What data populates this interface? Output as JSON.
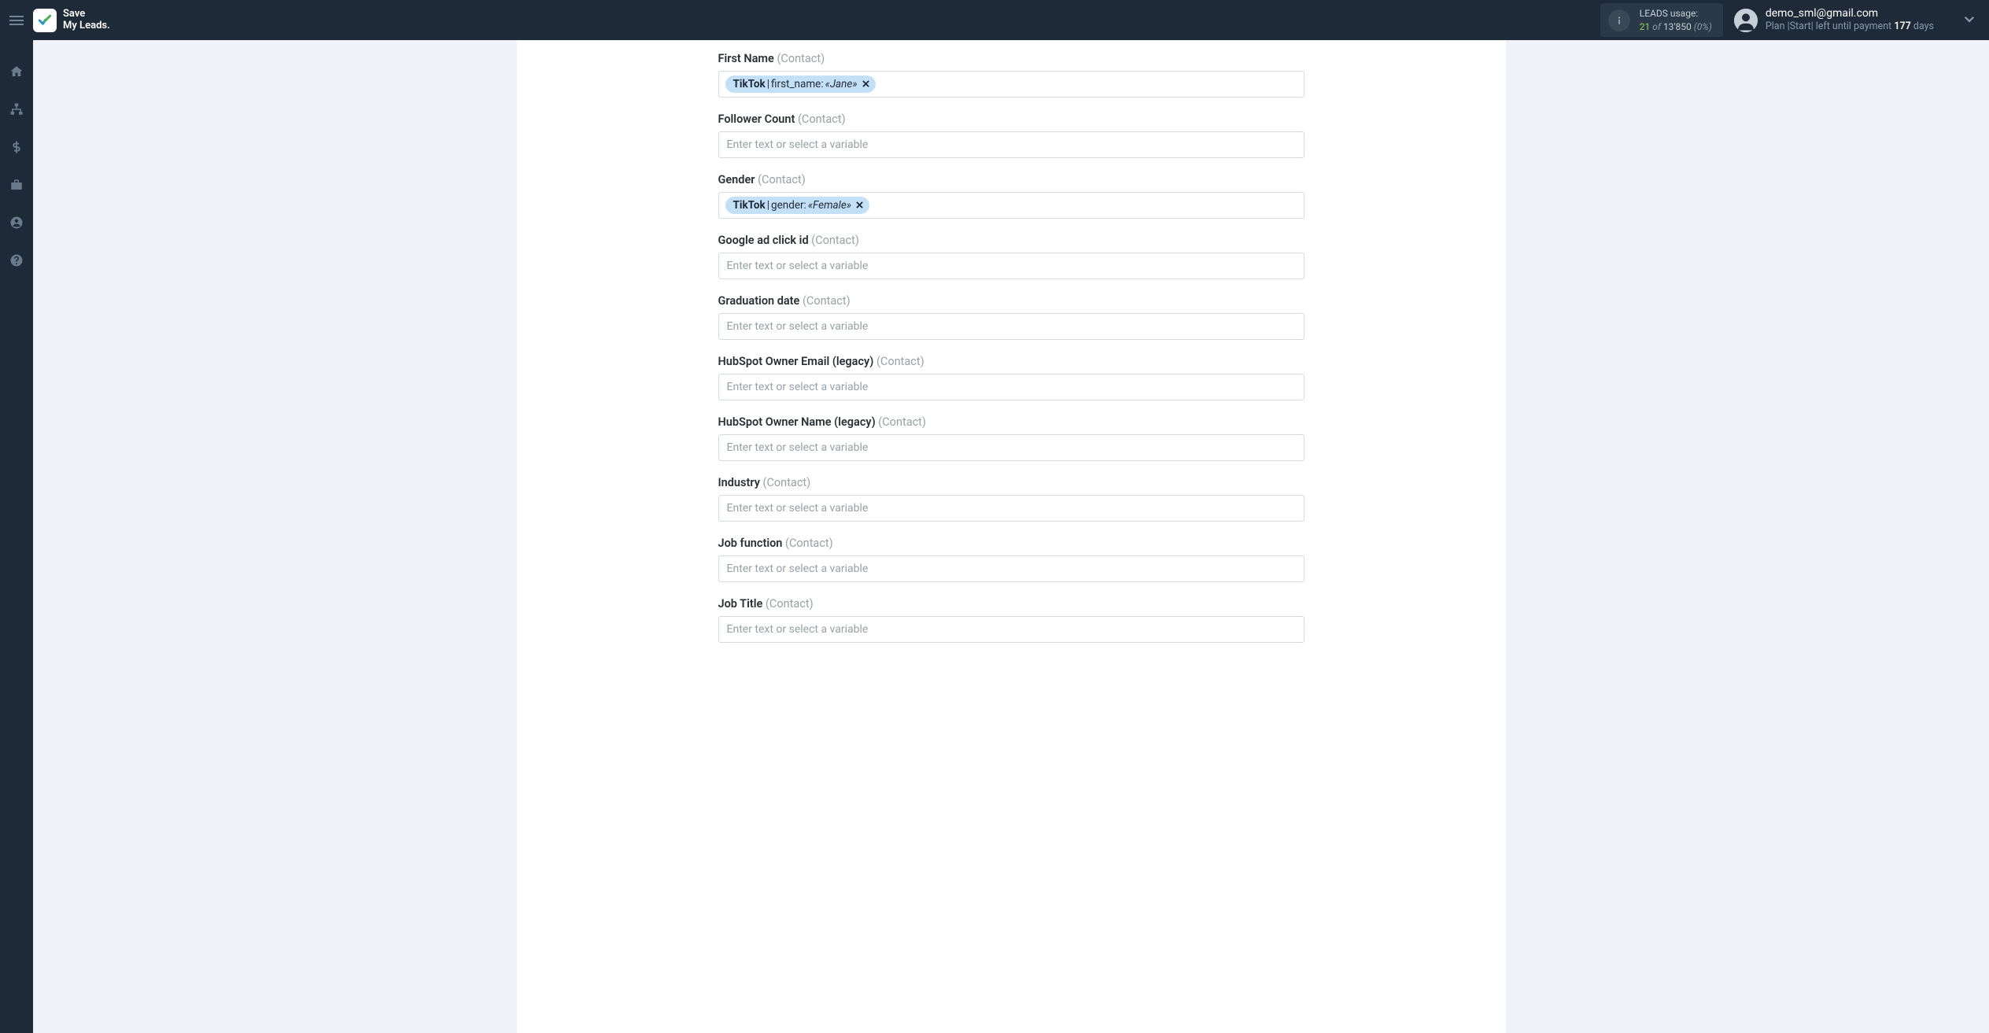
{
  "header": {
    "logo_line1": "Save",
    "logo_line2": "My Leads.",
    "usage": {
      "label": "LEADS usage:",
      "used": "21",
      "of": "of",
      "total": "13'850",
      "pct": "(0%)"
    },
    "account": {
      "email": "demo_sml@gmail.com",
      "plan_prefix": "Plan |Start| left until payment ",
      "days": "177",
      "days_suffix": " days"
    }
  },
  "placeholder": "Enter text or select a variable",
  "fields": [
    {
      "label": "First Name",
      "ctx": "(Contact)",
      "chip": {
        "source": "TikTok",
        "field": "first_name:",
        "sample": "«Jane»"
      }
    },
    {
      "label": "Follower Count",
      "ctx": "(Contact)",
      "chip": null
    },
    {
      "label": "Gender",
      "ctx": "(Contact)",
      "chip": {
        "source": "TikTok",
        "field": "gender:",
        "sample": "«Female»"
      }
    },
    {
      "label": "Google ad click id",
      "ctx": "(Contact)",
      "chip": null
    },
    {
      "label": "Graduation date",
      "ctx": "(Contact)",
      "chip": null
    },
    {
      "label": "HubSpot Owner Email (legacy)",
      "ctx": "(Contact)",
      "chip": null
    },
    {
      "label": "HubSpot Owner Name (legacy)",
      "ctx": "(Contact)",
      "chip": null
    },
    {
      "label": "Industry",
      "ctx": "(Contact)",
      "chip": null
    },
    {
      "label": "Job function",
      "ctx": "(Contact)",
      "chip": null
    },
    {
      "label": "Job Title",
      "ctx": "(Contact)",
      "chip": null
    }
  ]
}
